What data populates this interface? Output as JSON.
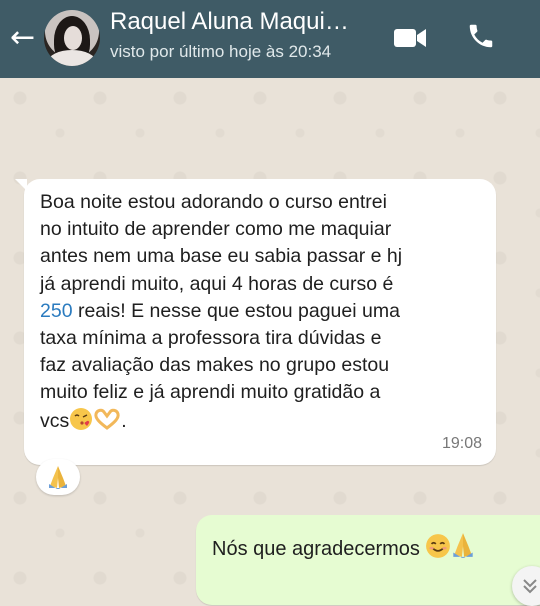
{
  "header": {
    "back_icon": "arrow-left-icon",
    "contact_name": "Raquel Aluna Maqui…",
    "status": "visto por último hoje às 20:34",
    "video_icon": "video-camera-icon",
    "phone_icon": "phone-icon",
    "background": "#3f5b66"
  },
  "messages": {
    "incoming": {
      "line1": "Boa noite  estou adorando o curso entrei",
      "line2": "no  intuito de aprender como me maquiar",
      "line3": "antes nem uma base eu sabia passar e hj",
      "line4": "já aprendi muito, aqui 4 horas de curso é",
      "line5_link": "250",
      "line5_rest": " reais! E nesse que estou paguei uma",
      "line6": "taxa mínima a professora  tira dúvidas e",
      "line7": "faz avaliação das makes no grupo estou",
      "line8": "muito feliz e já aprendi muito gratidão a",
      "line9": "vcs",
      "line9_end": ".",
      "emoji1": "kissing-face-icon",
      "emoji2": "heart-hands-icon",
      "time": "19:08",
      "reaction": "folded-hands-icon"
    },
    "outgoing": {
      "text": "Nós que agradecermos",
      "emoji1": "smiling-face-icon",
      "emoji2": "folded-hands-icon"
    }
  },
  "colors": {
    "chat_background": "#e9e2d8",
    "incoming_bubble": "#ffffff",
    "outgoing_bubble": "#e6fcd2",
    "link": "#2b7bbf"
  }
}
